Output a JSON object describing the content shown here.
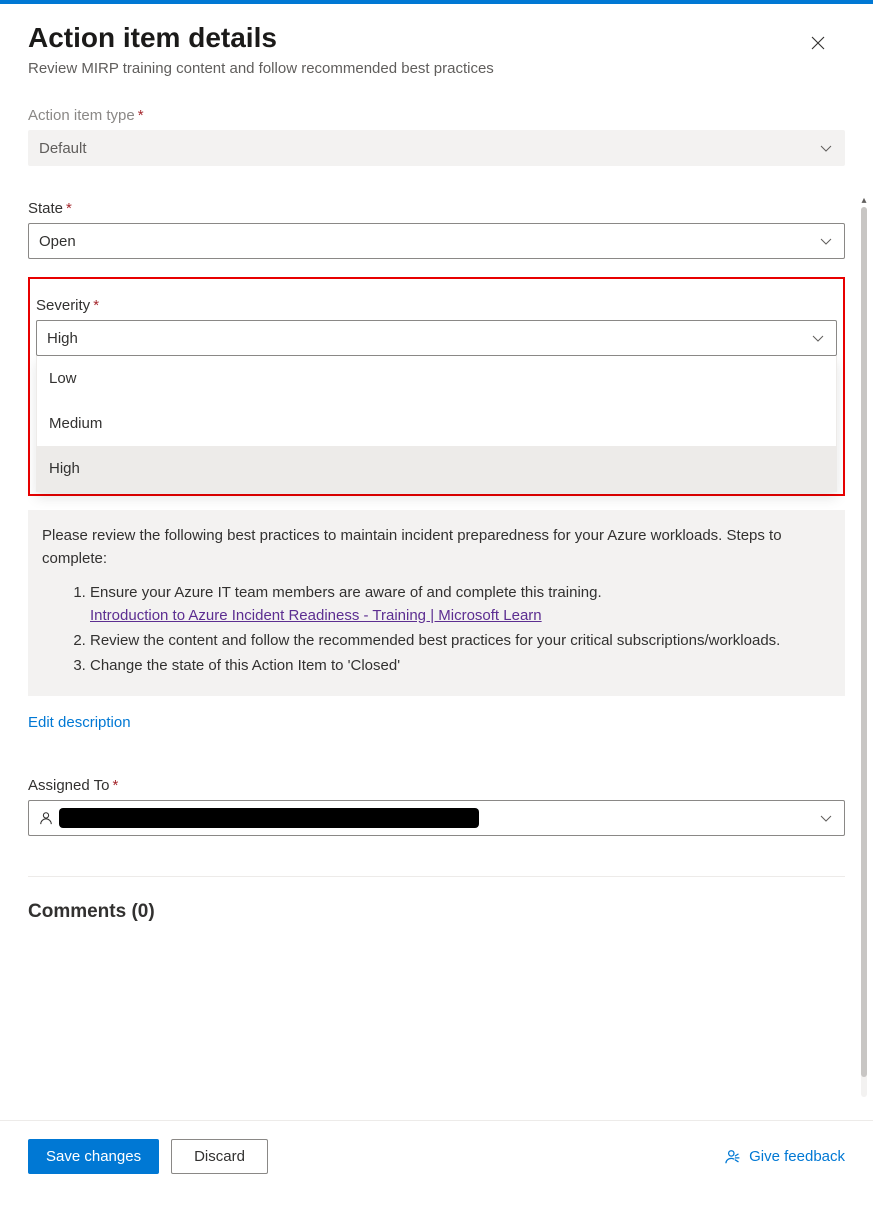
{
  "header": {
    "title": "Action item details",
    "subtitle": "Review MIRP training content and follow recommended best practices"
  },
  "fields": {
    "type": {
      "label": "Action item type",
      "value": "Default"
    },
    "state": {
      "label": "State",
      "value": "Open"
    },
    "severity": {
      "label": "Severity",
      "value": "High",
      "options": {
        "0": "Low",
        "1": "Medium",
        "2": "High"
      }
    },
    "description": {
      "intro": "Please review the following best practices to maintain incident preparedness for your Azure workloads. Steps to complete:",
      "step1": "Ensure your Azure IT team members are aware of and complete this training.",
      "step1_link": "Introduction to Azure Incident Readiness - Training | Microsoft Learn",
      "step2": "Review the content and follow the recommended best practices for your critical subscriptions/workloads.",
      "step3": "Change the state of this Action Item to 'Closed'",
      "edit": "Edit description"
    },
    "assigned": {
      "label": "Assigned To"
    }
  },
  "comments": {
    "heading": "Comments (0)"
  },
  "footer": {
    "save": "Save changes",
    "discard": "Discard",
    "feedback": "Give feedback"
  }
}
